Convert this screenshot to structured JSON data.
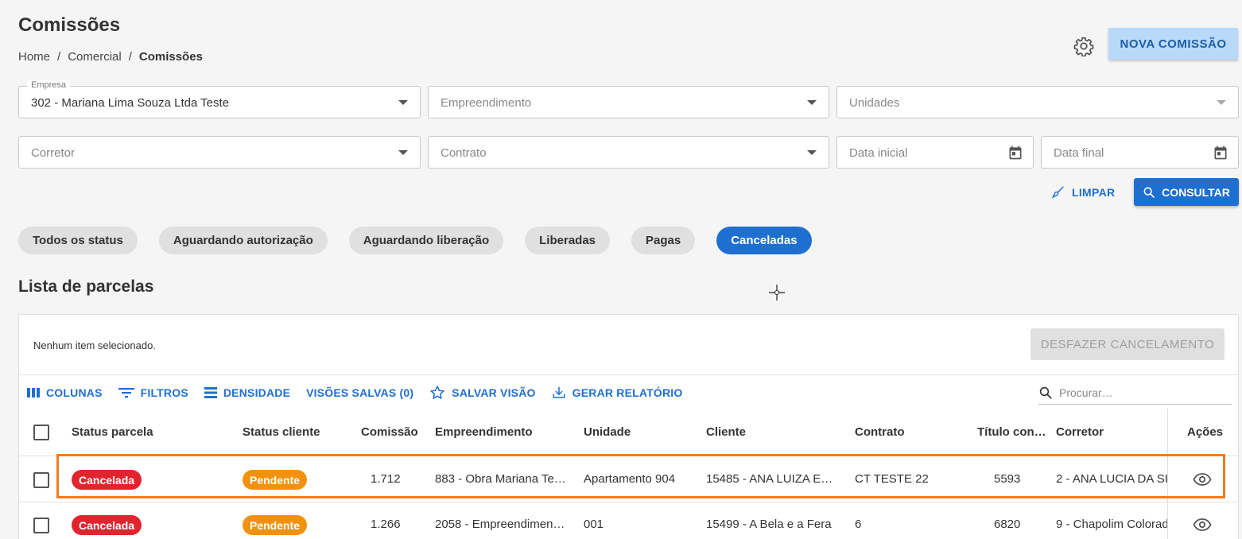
{
  "page": {
    "title": "Comissões",
    "breadcrumb": [
      "Home",
      "/",
      "Comercial",
      "/",
      "Comissões"
    ],
    "nova_comissao_label": "NOVA COMISSÃO"
  },
  "filters": {
    "empresa": {
      "legend": "Empresa",
      "value": "302 - Mariana  Lima Souza Ltda Teste"
    },
    "empreendimento": {
      "placeholder": "Empreendimento"
    },
    "unidades": {
      "placeholder": "Unidades"
    },
    "corretor": {
      "placeholder": "Corretor"
    },
    "contrato": {
      "placeholder": "Contrato"
    },
    "data_inicial": {
      "placeholder": "Data inicial"
    },
    "data_final": {
      "placeholder": "Data final"
    },
    "limpar_label": "LIMPAR",
    "consultar_label": "CONSULTAR"
  },
  "status_chips": [
    {
      "label": "Todos os status",
      "active": false
    },
    {
      "label": "Aguardando autorização",
      "active": false
    },
    {
      "label": "Aguardando liberação",
      "active": false
    },
    {
      "label": "Liberadas",
      "active": false
    },
    {
      "label": "Pagas",
      "active": false
    },
    {
      "label": "Canceladas",
      "active": true
    }
  ],
  "list": {
    "title": "Lista de parcelas",
    "selection_text": "Nenhum item selecionado.",
    "desfazer_label": "DESFAZER CANCELAMENTO",
    "toolbar": {
      "colunas": "COLUNAS",
      "filtros": "FILTROS",
      "densidade": "DENSIDADE",
      "visoes_salvas": "VISÕES SALVAS (0)",
      "salvar_visao": "SALVAR VISÃO",
      "gerar_relatorio": "GERAR RELATÓRIO"
    },
    "search_placeholder": "Procurar…",
    "columns": {
      "status_parcela": "Status parcela",
      "status_cliente": "Status cliente",
      "comissao": "Comissão",
      "empreendimento": "Empreendimento",
      "unidade": "Unidade",
      "cliente": "Cliente",
      "contrato": "Contrato",
      "titulo": "Título con…",
      "corretor": "Corretor",
      "acoes": "Ações"
    },
    "rows": [
      {
        "status_parcela": "Cancelada",
        "status_cliente": "Pendente",
        "comissao": "1.712",
        "empreendimento": "883 - Obra Mariana Te…",
        "unidade": "Apartamento 904",
        "cliente": "15485 - ANA LUIZA E…",
        "contrato": "CT TESTE 22",
        "titulo": "5593",
        "corretor": "2 - ANA LUCIA DA SI"
      },
      {
        "status_parcela": "Cancelada",
        "status_cliente": "Pendente",
        "comissao": "1.266",
        "empreendimento": "2058 - Empreendimen…",
        "unidade": "001",
        "cliente": "15499 - A Bela e a Fera",
        "contrato": "6",
        "titulo": "6820",
        "corretor": "9 - Chapolim Colorad"
      }
    ]
  },
  "colors": {
    "primary": "#1e6fcf",
    "cancelada": "#e0252f",
    "pendente": "#f2920c",
    "highlight": "#f07c1f"
  }
}
